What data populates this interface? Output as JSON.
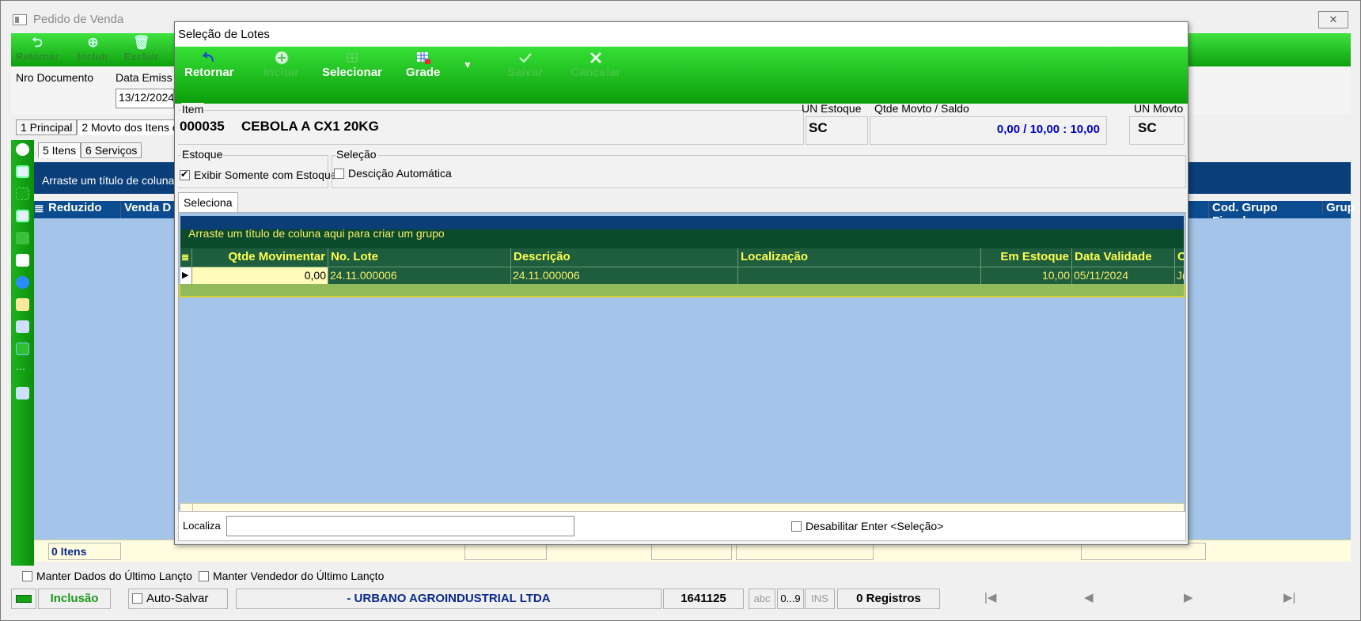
{
  "bg": {
    "title": "Pedido de Venda",
    "toolbar": [
      "Retornar",
      "Incluir",
      "Excluir"
    ],
    "fields": {
      "nro_documento_label": "Nro Documento",
      "data_emissao_label": "Data Emiss",
      "data_emissao_value": "13/12/2024"
    },
    "tabs": [
      "1 Principal",
      "2 Movto dos Itens e"
    ],
    "subtabs": [
      "5 Itens",
      "6 Serviços"
    ],
    "group_hint": "Arraste um título de coluna",
    "columns": [
      "Reduzido",
      "Venda D",
      "Cod. Grupo Fiscal",
      "Grup"
    ],
    "footer_count": "0 Itens",
    "check_manter_dados": "Manter Dados do Último Lançto",
    "check_manter_vendedor": "Manter Vendedor do Último Lançto"
  },
  "status": {
    "mode": "Inclusão",
    "auto_salvar": "Auto-Salvar",
    "empresa": "- URBANO AGROINDUSTRIAL LTDA",
    "codigo": "1641125",
    "abc": "abc",
    "num": "0...9",
    "ins": "INS",
    "registros": "0 Registros"
  },
  "dialog": {
    "title": "Seleção de Lotes",
    "toolbar": {
      "retornar": "Retornar",
      "incluir": "Incluir",
      "selecionar": "Selecionar",
      "grade": "Grade",
      "salvar": "Salvar",
      "cancelar": "Cancelar"
    },
    "item": {
      "label": "Item",
      "code": "000035",
      "description": "CEBOLA A CX1 20KG",
      "un_estoque_label": "UN Estoque",
      "un_estoque": "SC",
      "qtde_label": "Qtde Movto / Saldo",
      "qtde_value": "0,00 / 10,00 : 10,00",
      "un_movto_label": "UN Movto",
      "un_movto": "SC"
    },
    "estoque_label": "Estoque",
    "exibir_somente": "Exibir Somente com Estoque",
    "selecao_label": "Seleção",
    "desc_automatica": "Descição Automática",
    "tab": "Seleciona",
    "grid": {
      "group_hint": "Arraste um título de coluna aqui para criar um grupo",
      "headers": [
        "Qtde Movimentar",
        "No. Lote",
        "Descrição",
        "Localização",
        "Em Estoque",
        "Data Validade",
        "C"
      ],
      "rows": [
        {
          "qtde": "0,00",
          "lote": "24.11.000006",
          "descricao": "24.11.000006",
          "localizacao": "",
          "estoque": "10,00",
          "validade": "05/11/2024",
          "c": "J("
        }
      ]
    },
    "localiza_label": "Localiza",
    "localiza_value": "",
    "desabilitar_enter": "Desabilitar Enter <Seleção>"
  },
  "colors": {
    "toolbar_green": "#1cb51c",
    "grid_blue": "#a4c4ea",
    "header_dark": "#0b3d76",
    "row_green": "#1e5e3e",
    "row_text": "#f5ef6a",
    "value_blue": "#0000c8"
  }
}
